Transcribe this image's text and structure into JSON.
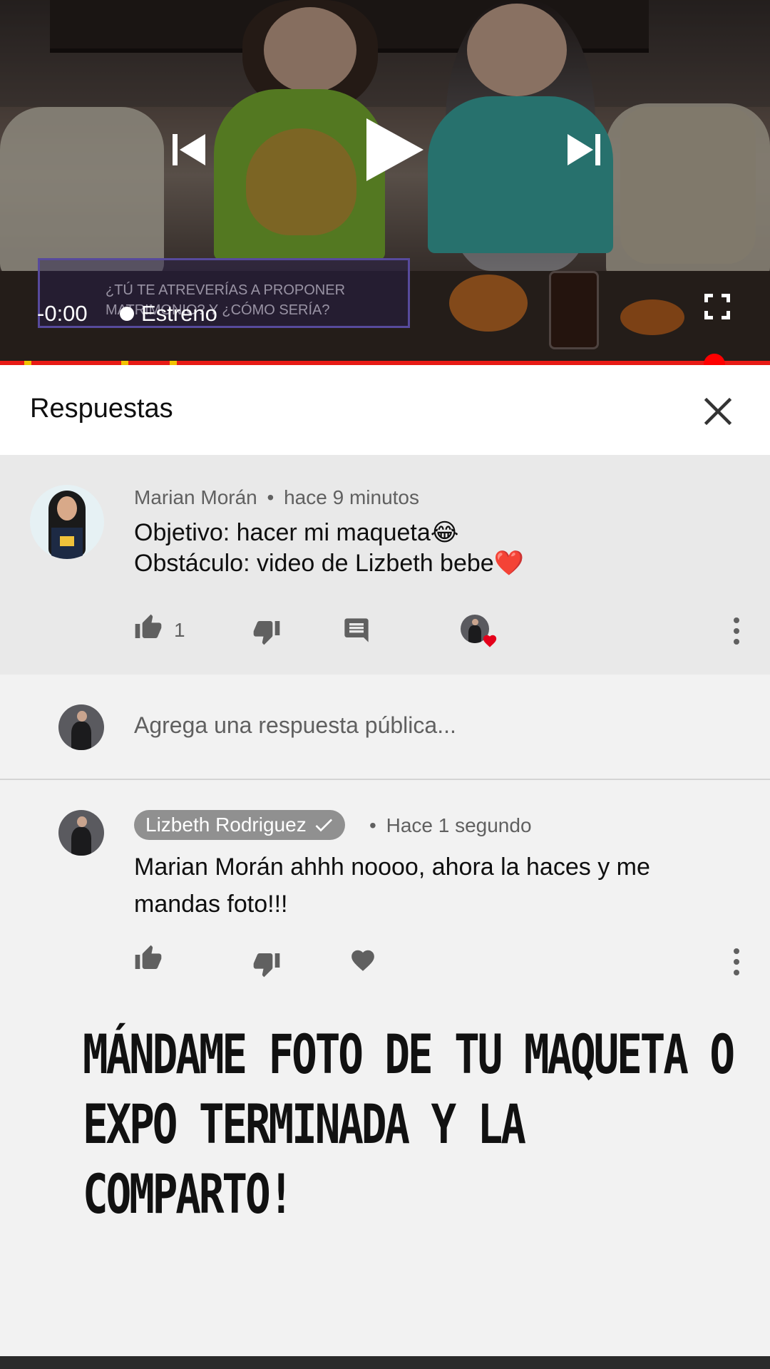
{
  "player": {
    "banner_text": "¿TÚ TE ATREVERÍAS A PROPONER MATRIMONIO? Y ¿CÓMO SERÍA?",
    "time": "-0:00",
    "premiere_label": "Estreno",
    "progress_color": "#e91b16"
  },
  "responses": {
    "title": "Respuestas",
    "close_icon": "close-icon"
  },
  "comment": {
    "author": "Marian Morán",
    "separator": "•",
    "time": "hace 9 minutos",
    "line1": "Objetivo: hacer mi maqueta😂",
    "line2": "Obstáculo: video de Lizbeth bebe❤️",
    "likes": "1",
    "icons": [
      "like-icon",
      "dislike-icon",
      "reply-icon",
      "creator-heart-icon",
      "more-icon"
    ]
  },
  "reply_box": {
    "placeholder": "Agrega una respuesta pública..."
  },
  "reply": {
    "author": "Lizbeth Rodriguez",
    "separator": "•",
    "time": "Hace 1 segundo",
    "text": "Marian Morán ahhh noooo, ahora la haces y me mandas foto!!!",
    "icons": [
      "like-icon",
      "dislike-icon",
      "heart-icon",
      "more-icon"
    ]
  },
  "caption": {
    "line1": "MÁNDAME FOTO DE TU MAQUETA O",
    "line2": "EXPO TERMINADA Y LA COMPARTO!"
  },
  "colors": {
    "accent_red": "#ff0000",
    "heart_red": "#e4001b",
    "text_secondary": "#606060"
  }
}
